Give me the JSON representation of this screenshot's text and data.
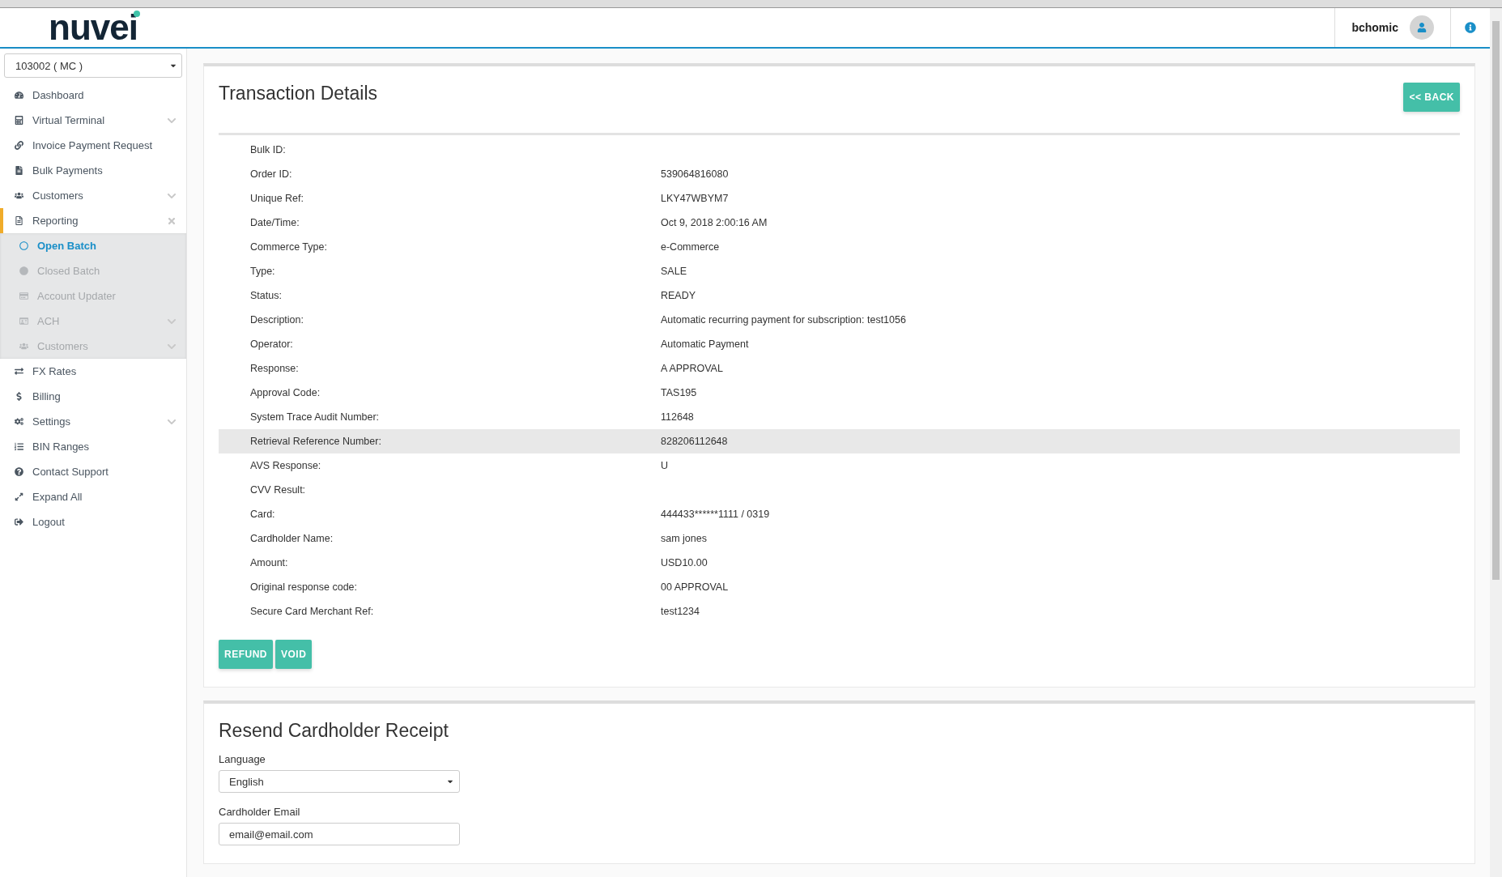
{
  "header": {
    "logo": "nuvei",
    "username": "bchomic"
  },
  "sidebar": {
    "merchant_select": "103002 ( MC )",
    "items": [
      {
        "label": "Dashboard",
        "kind": "plain"
      },
      {
        "label": "Virtual Terminal",
        "kind": "expandable",
        "expanded": false
      },
      {
        "label": "Invoice Payment Request",
        "kind": "plain"
      },
      {
        "label": "Bulk Payments",
        "kind": "plain"
      },
      {
        "label": "Customers",
        "kind": "expandable",
        "expanded": false
      },
      {
        "label": "Reporting",
        "kind": "expandable",
        "expanded": true,
        "children": [
          {
            "label": "Open Batch",
            "selected": true,
            "kind": "plain"
          },
          {
            "label": "Closed Batch",
            "selected": false,
            "kind": "plain"
          },
          {
            "label": "Account Updater",
            "selected": false,
            "kind": "plain"
          },
          {
            "label": "ACH",
            "selected": false,
            "kind": "expandable"
          },
          {
            "label": "Customers",
            "selected": false,
            "kind": "expandable"
          }
        ]
      },
      {
        "label": "FX Rates",
        "kind": "plain"
      },
      {
        "label": "Billing",
        "kind": "plain"
      },
      {
        "label": "Settings",
        "kind": "expandable",
        "expanded": false
      },
      {
        "label": "BIN Ranges",
        "kind": "plain"
      },
      {
        "label": "Contact Support",
        "kind": "plain"
      },
      {
        "label": "Expand All",
        "kind": "plain"
      },
      {
        "label": "Logout",
        "kind": "plain"
      }
    ]
  },
  "details": {
    "title": "Transaction Details",
    "back_button": "<< BACK",
    "rows": [
      {
        "label": "Bulk ID:",
        "value": "",
        "selected": false
      },
      {
        "label": "Order ID:",
        "value": "539064816080",
        "selected": false
      },
      {
        "label": "Unique Ref:",
        "value": "LKY47WBYM7",
        "selected": false
      },
      {
        "label": "Date/Time:",
        "value": "Oct 9, 2018 2:00:16 AM",
        "selected": false
      },
      {
        "label": "Commerce Type:",
        "value": "e-Commerce",
        "selected": false
      },
      {
        "label": "Type:",
        "value": "SALE",
        "selected": false
      },
      {
        "label": "Status:",
        "value": "READY",
        "selected": false
      },
      {
        "label": "Description:",
        "value": "Automatic recurring payment for subscription: test1056",
        "selected": false
      },
      {
        "label": "Operator:",
        "value": "Automatic Payment",
        "selected": false
      },
      {
        "label": "Response:",
        "value": "A APPROVAL",
        "selected": false
      },
      {
        "label": "Approval Code:",
        "value": "TAS195",
        "selected": false
      },
      {
        "label": "System Trace Audit Number:",
        "value": "112648",
        "selected": false
      },
      {
        "label": "Retrieval Reference Number:",
        "value": "828206112648",
        "selected": true
      },
      {
        "label": "AVS Response:",
        "value": "U",
        "selected": false
      },
      {
        "label": "CVV Result:",
        "value": "",
        "selected": false
      },
      {
        "label": "Card:",
        "value": "444433******1111 / 0319",
        "selected": false
      },
      {
        "label": "Cardholder Name:",
        "value": "sam jones",
        "selected": false
      },
      {
        "label": "Amount:",
        "value": "USD10.00",
        "selected": false
      },
      {
        "label": "Original response code:",
        "value": "00 APPROVAL",
        "selected": false
      },
      {
        "label": "Secure Card Merchant Ref:",
        "value": "test1234",
        "selected": false
      }
    ],
    "actions": [
      "REFUND",
      "VOID"
    ]
  },
  "receipt": {
    "title": "Resend Cardholder Receipt",
    "language_label": "Language",
    "language_value": "English",
    "email_label": "Cardholder Email",
    "email_value": "email@email.com"
  }
}
